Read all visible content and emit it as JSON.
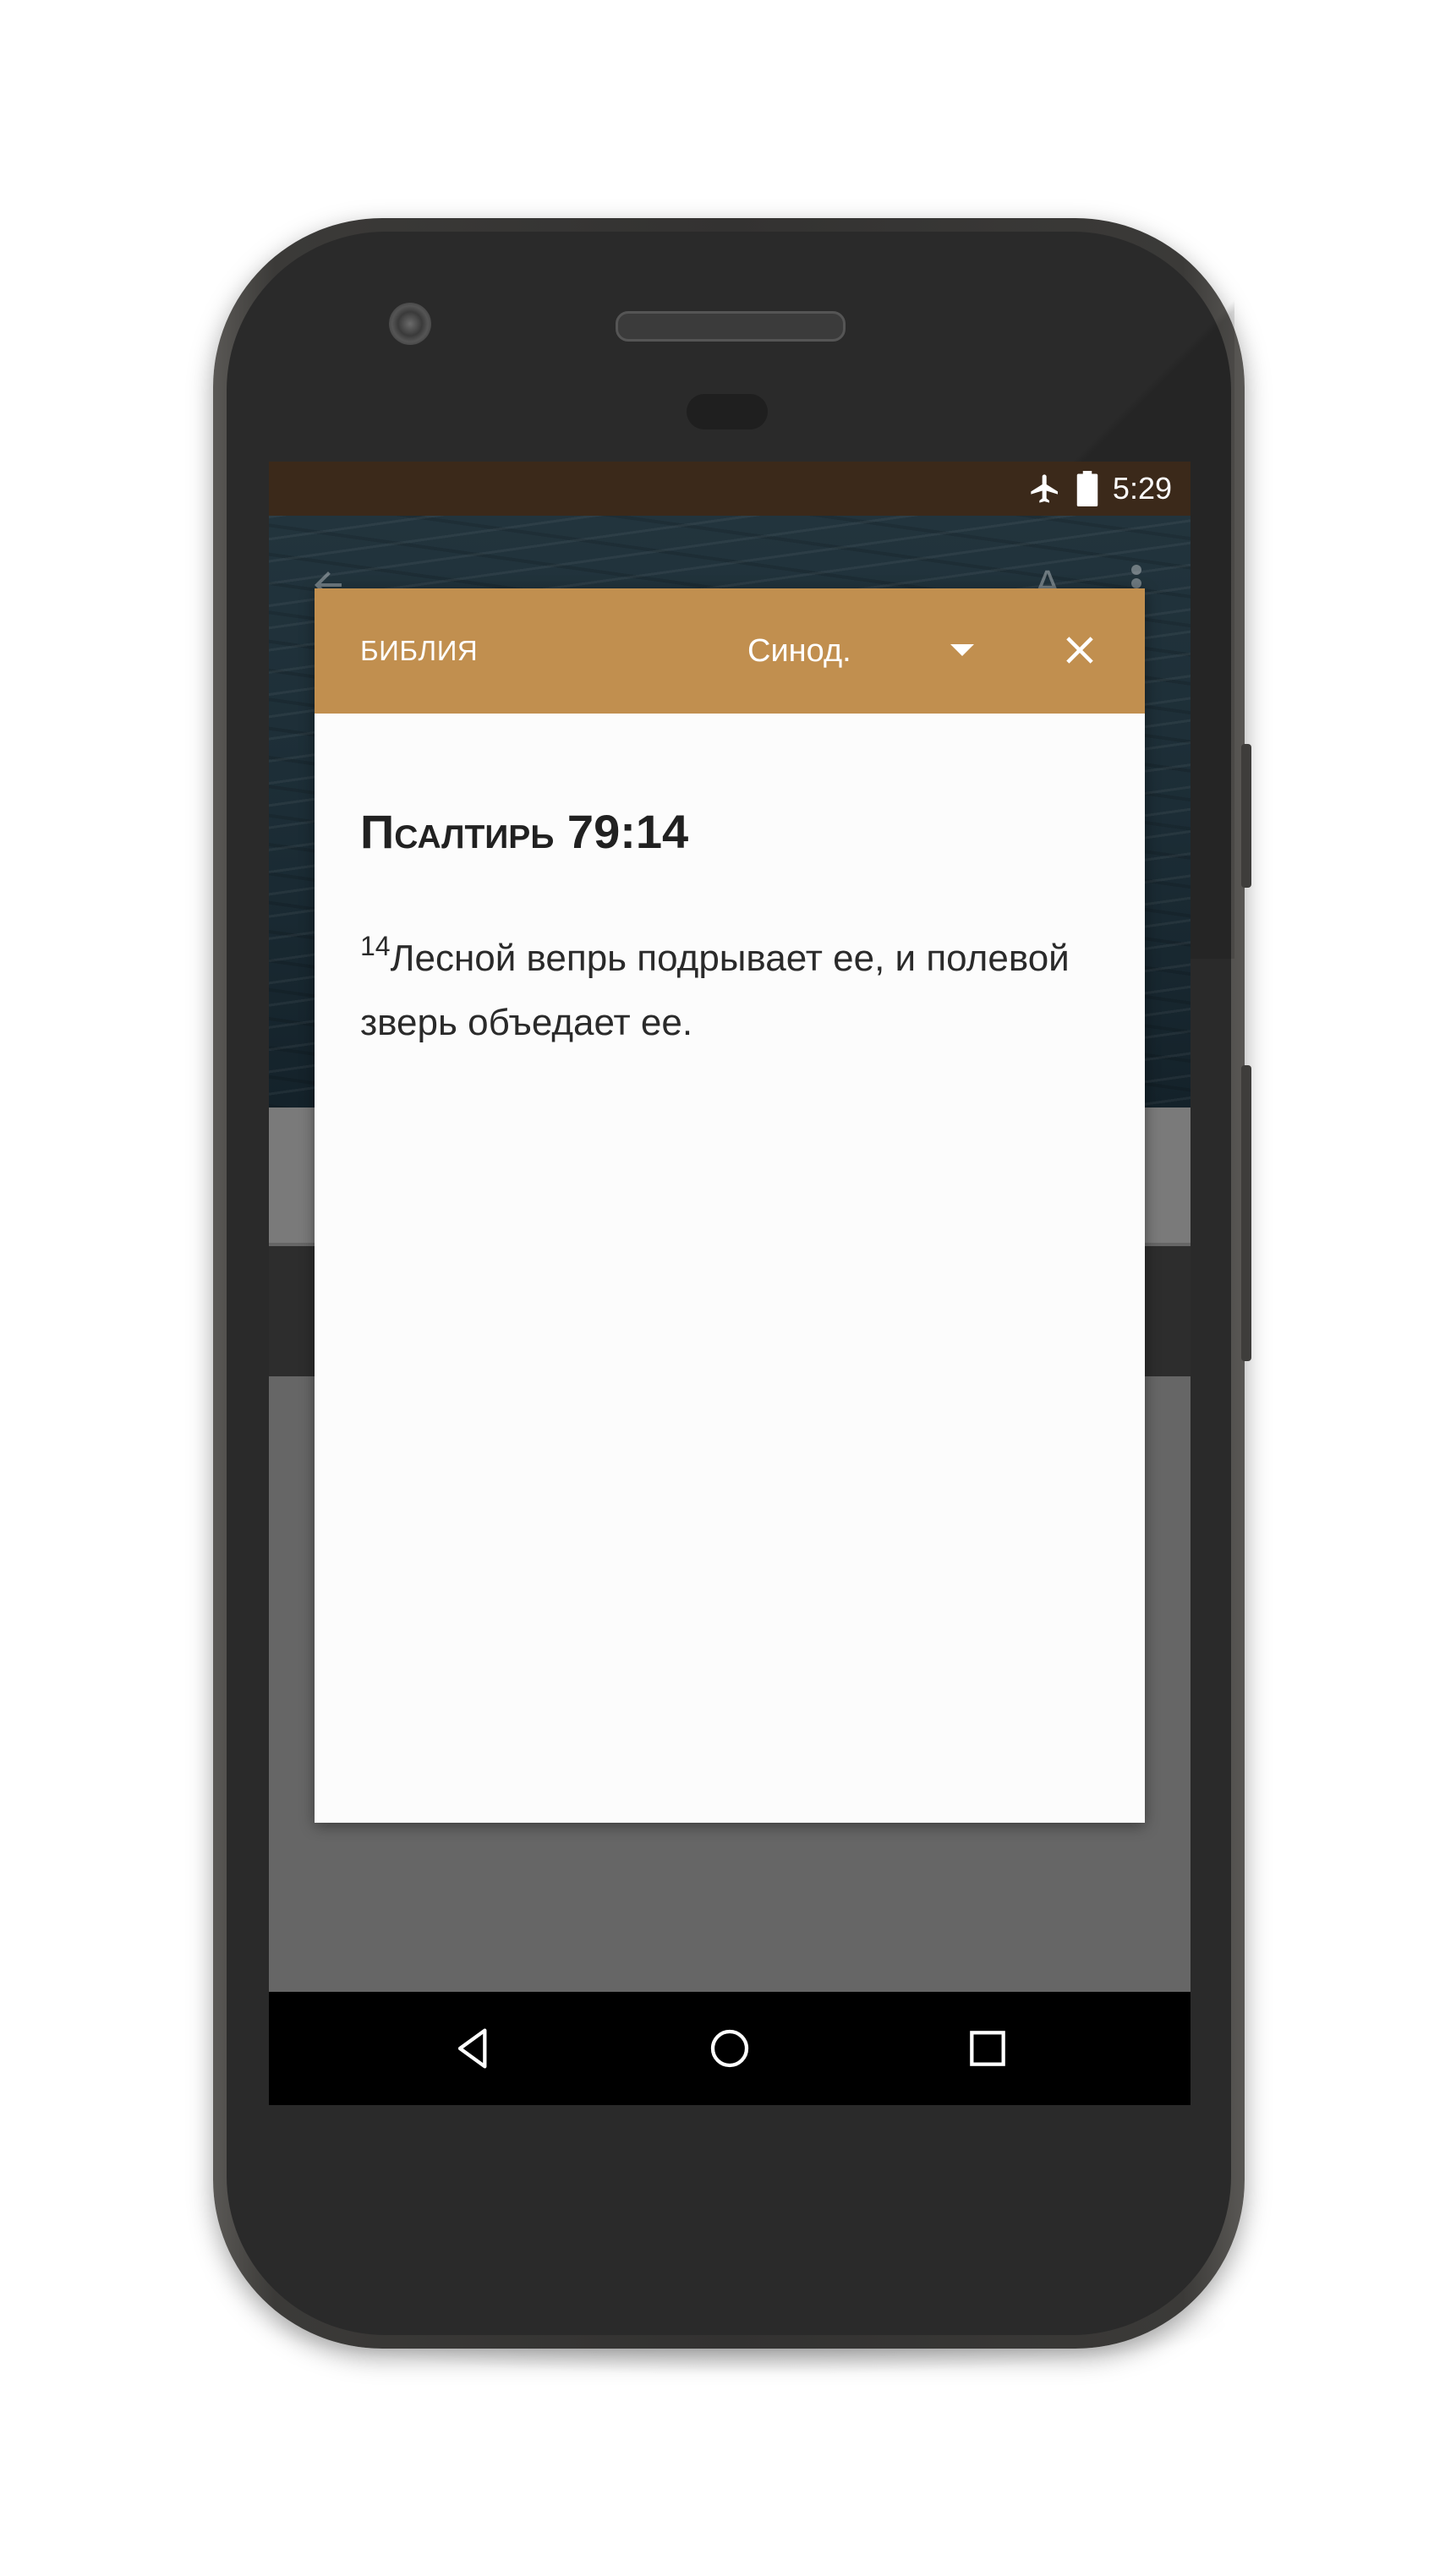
{
  "status_bar": {
    "time": "5:29",
    "icons": [
      "airplane-mode-icon",
      "battery-icon"
    ]
  },
  "app_bar": {
    "icons": [
      "back-arrow-icon",
      "font-size-icon",
      "overflow-menu-icon"
    ]
  },
  "dialog": {
    "title": "БИБЛИЯ",
    "version": "Синод.",
    "close_icon": "close-icon",
    "dropdown_icon": "dropdown-arrow-icon",
    "reference_first": "П",
    "reference_rest": "салтирь",
    "reference_numbers": "79:14",
    "verse_number": "14",
    "verse_text": "Лесной вепрь подрывает ее, и полевой зверь объедает ее."
  },
  "nav_bar": {
    "icons": [
      "back-triangle-icon",
      "home-circle-icon",
      "recents-square-icon"
    ]
  },
  "colors": {
    "header_accent": "#c18f4f",
    "status_bar": "#3b291a",
    "dialog_background": "#fcfcfc"
  }
}
